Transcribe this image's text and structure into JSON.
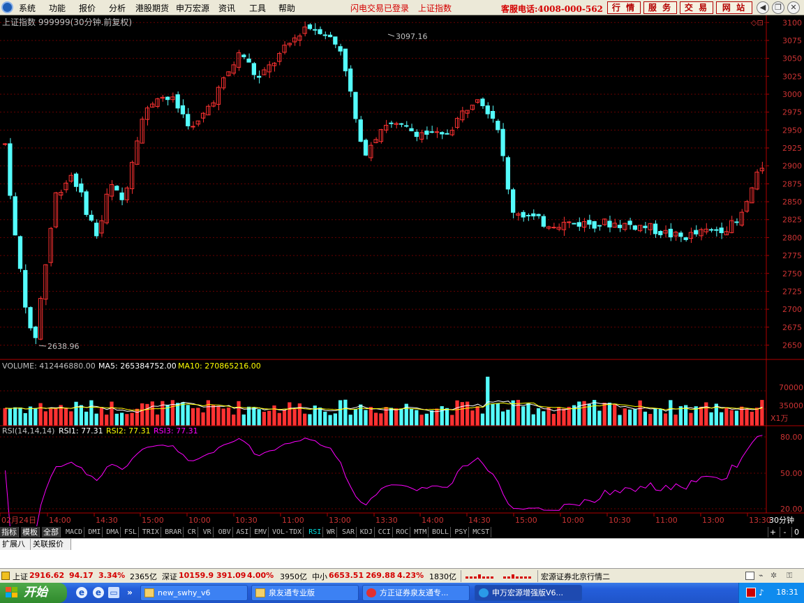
{
  "menu": {
    "items": [
      "系统",
      "功能",
      "报价",
      "分析",
      "港股期货",
      "申万宏源",
      "资讯",
      "工具",
      "帮助"
    ],
    "status1": "闪电交易已登录",
    "status2": "上证指数",
    "hotline": "客服电话:4008-000-562",
    "nav": [
      "行 情",
      "服 务",
      "交 易",
      "网 站"
    ]
  },
  "main": {
    "title": "上证指数 999999(30分钟.前复权)",
    "high_label": "3097.16",
    "low_label": "2638.96",
    "price_ticks": [
      "3100",
      "3075",
      "3050",
      "3025",
      "3000",
      "2975",
      "2950",
      "2925",
      "2900",
      "2875",
      "2850",
      "2825",
      "2800",
      "2775",
      "2750",
      "2725",
      "2700",
      "2675",
      "2650"
    ]
  },
  "volume": {
    "label": "VOLUME: 412446880.00",
    "ma5": "MA5: 265384752.00",
    "ma10": "MA10: 270865216.00",
    "ticks": [
      "70000",
      "35000"
    ],
    "unit": "X1万"
  },
  "rsi": {
    "label": "RSI(14,14,14)",
    "r1": "RSI1: 77.31",
    "r2": "RSI2: 77.31",
    "r3": "RSI3: 77.31",
    "ticks": [
      "80.00",
      "50.00",
      "20.00"
    ]
  },
  "time_axis": {
    "labels": [
      "02月24日",
      "14:00",
      "14:30",
      "15:00",
      "10:00",
      "10:30",
      "11:00",
      "13:00",
      "13:30",
      "14:00",
      "14:30",
      "15:00",
      "10:00",
      "10:30",
      "11:00",
      "13:00",
      "13:30"
    ],
    "period": "30分钟"
  },
  "indicator_tabs": [
    "指标",
    "模板",
    "全部",
    "MACD",
    "DMI",
    "DMA",
    "FSL",
    "TRIX",
    "BRAR",
    "CR",
    "VR",
    "OBV",
    "ASI",
    "EMV",
    "VOL-TDX",
    "RSI",
    "WR",
    "SAR",
    "KDJ",
    "CCI",
    "ROC",
    "MTM",
    "BOLL",
    "PSY",
    "MCST"
  ],
  "indicator_ctrl": [
    "+",
    "-",
    "0"
  ],
  "sub_tabs": [
    "扩展八",
    "关联报价"
  ],
  "statusbar": {
    "sh_name": "上证",
    "sh_val": "2916.62",
    "sh_chg": "94.17",
    "sh_pct": "3.34%",
    "sh_amt": "2365亿",
    "sz_name": "深证",
    "sz_val": "10159.9",
    "sz_chg": "391.09",
    "sz_pct": "4.00%",
    "sz_amt": "3950亿",
    "zx_name": "中小",
    "zx_val": "6653.51",
    "zx_chg": "269.88",
    "zx_pct": "4.23%",
    "zx_amt": "1830亿",
    "broker": "宏源证券北京行情二"
  },
  "taskbar": {
    "start": "开始",
    "tasks": [
      "new_swhy_v6",
      "泉友通专业版",
      "方正证券泉友通专...",
      "申万宏源增强版V6..."
    ],
    "clock": "18:31"
  },
  "colors": {
    "up": "#ff3232",
    "down": "#54fcfc",
    "ma5": "#ffffff",
    "ma10": "#ffff00",
    "rsi3": "#ff00ff",
    "axis": "#b00000"
  },
  "chart_data": {
    "type": "candlestick",
    "price_ylim": [
      2630,
      3110
    ],
    "high": 3097.16,
    "low": 2638.96,
    "bars": 150,
    "rsi_ylim": [
      15,
      85
    ]
  }
}
